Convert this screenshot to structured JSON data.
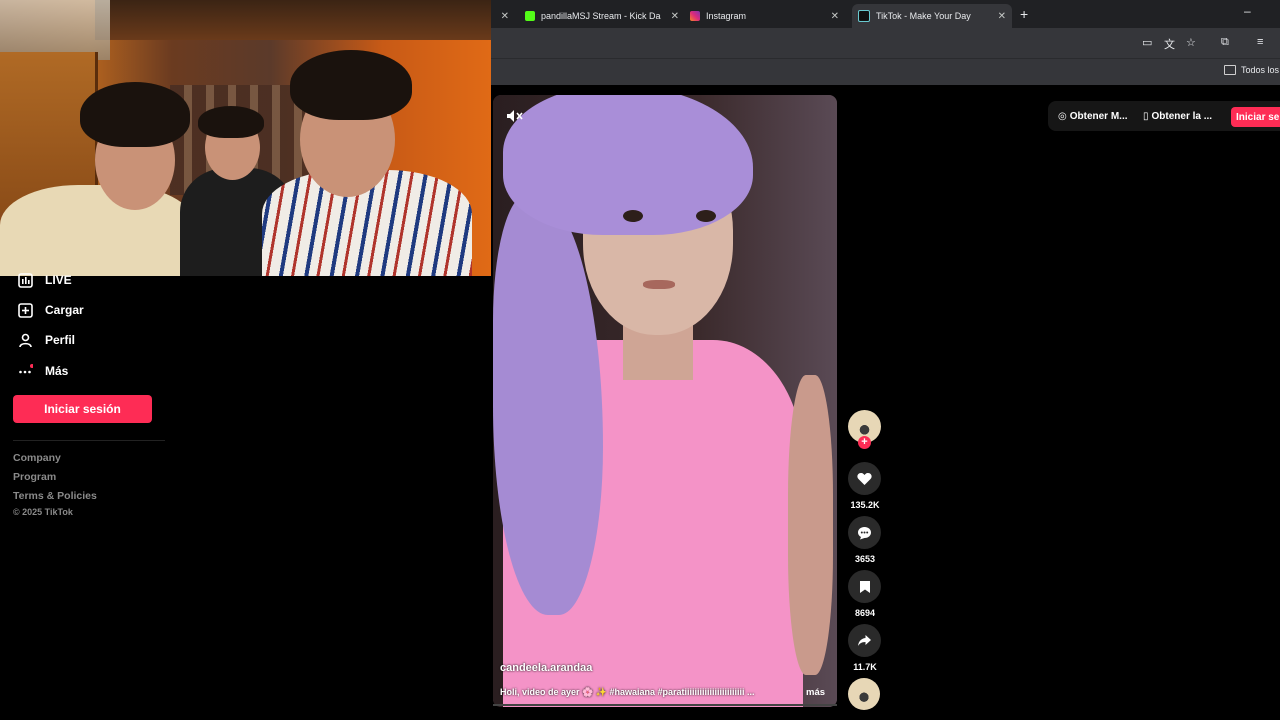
{
  "browser": {
    "tabs": [
      {
        "title": "",
        "favicon_color": "#202124"
      },
      {
        "title": "pandillaMSJ Stream - Kick Dash",
        "favicon_color": "#53fc18"
      },
      {
        "title": "Instagram",
        "favicon_color": "#e1306c"
      },
      {
        "title": "TikTok - Make Your Day",
        "favicon_color": "#111111"
      }
    ],
    "new_tab_symbol": "+",
    "close_symbol": "✕",
    "minimize_symbol": "–",
    "bookmarks_folder": "Todos los m"
  },
  "sidebar": {
    "items": [
      {
        "label": "LIVE",
        "icon": "live-icon"
      },
      {
        "label": "Cargar",
        "icon": "upload-icon"
      },
      {
        "label": "Perfil",
        "icon": "profile-icon"
      },
      {
        "label": "Más",
        "icon": "more-icon"
      }
    ],
    "login_button": "Iniciar sesión",
    "footer_links": [
      "Company",
      "Program",
      "Terms & Policies"
    ],
    "copyright": "© 2025 TikTok"
  },
  "header": {
    "get_coins": "Obtener M...",
    "get_app": "Obtener la ...",
    "login": "Iniciar se"
  },
  "video": {
    "author": "candeela.arandaa",
    "caption": "Holi, video de ayer 🌸 ✨ #hawaiana #paratiiiiiiiiiiiiiiiiiiiiiiii ...",
    "more": "más"
  },
  "actions": {
    "likes": "135.2K",
    "comments": "3653",
    "saves": "8694",
    "shares": "11.7K"
  },
  "colors": {
    "accent": "#fe2c55",
    "background": "#000000",
    "chrome": "#35363a"
  }
}
